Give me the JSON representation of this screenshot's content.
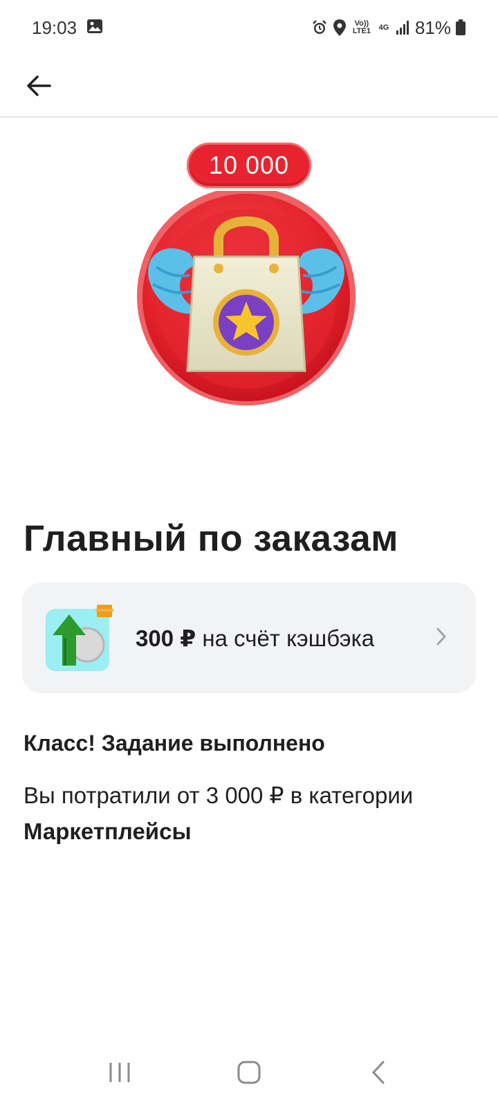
{
  "status_bar": {
    "time": "19:03",
    "battery": "81%",
    "volte_label": "Vo)) LTE1",
    "net_label": "4G",
    "icons": [
      "gallery-icon",
      "alarm-icon",
      "location-icon",
      "signal-icon",
      "battery-icon"
    ]
  },
  "app_bar": {
    "back_icon": "arrow-left-icon"
  },
  "hero": {
    "badge_count": "10 000",
    "image": "shopping-bag-with-wings-medal"
  },
  "title": "Главный по заказам",
  "reward": {
    "amount": "300 ₽",
    "text": " на счёт кэшбэка",
    "icon": "cashback-up-arrow-coin-icon"
  },
  "task": {
    "status": "Класс! Задание выполнено",
    "description": "Вы потратили от 3 000 ₽ в категории",
    "category": "Маркетплейсы"
  },
  "nav_bar": {
    "icons": [
      "recent-apps-icon",
      "home-icon",
      "back-icon"
    ]
  },
  "colors": {
    "accent_red": "#e8232f",
    "card_bg": "#f2f3f5",
    "text": "#1f1f22"
  }
}
